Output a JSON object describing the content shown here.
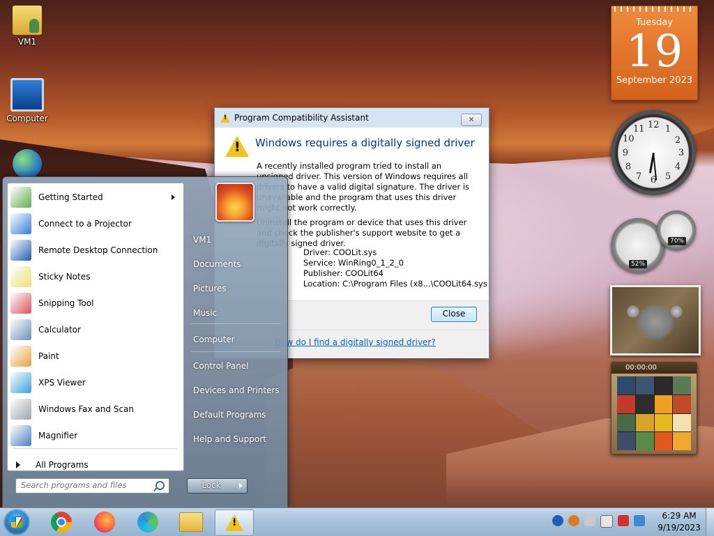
{
  "desktop": {
    "icons": [
      {
        "label": "VM1",
        "icon": "user-folder-icon"
      },
      {
        "label": "Computer",
        "icon": "computer-icon"
      },
      {
        "label": "",
        "icon": "network-icon"
      }
    ]
  },
  "gadgets": {
    "calendar": {
      "weekday": "Tuesday",
      "day": "19",
      "month_year": "September 2023"
    },
    "clock": {
      "numbers": [
        "12",
        "1",
        "2",
        "3",
        "4",
        "5",
        "6",
        "7",
        "8",
        "9",
        "10",
        "11"
      ]
    },
    "cpu_meter": {
      "cpu": "52%",
      "memory": "70%"
    },
    "puzzle": {
      "timer": "00:00:00"
    }
  },
  "dialog": {
    "title": "Program Compatibility Assistant",
    "heading": "Windows requires a digitally signed driver",
    "paragraph1": "A recently installed program tried to install an unsigned driver. This version of Windows requires all drivers to have a valid digital signature. The driver is unavailable and the program that uses this driver might not work correctly.",
    "paragraph2": "Uninstall the program or device that uses this driver and check the publisher's support website to get a digitally signed driver.",
    "driver": "Driver: COOLit.sys",
    "service": "Service: WinRing0_1_2_0",
    "publisher": "Publisher: COOLit64",
    "location": "Location: C:\\Program Files (x8...\\COOLit64.sys",
    "close_label": "Close",
    "link": "How do I find a digitally signed driver?"
  },
  "start_menu": {
    "programs": [
      {
        "label": "Getting Started",
        "icon": "getting-started-icon",
        "submenu": true,
        "color": "#5fae4c"
      },
      {
        "label": "Connect to a Projector",
        "icon": "projector-icon",
        "submenu": false,
        "color": "#2f7fd8"
      },
      {
        "label": "Remote Desktop Connection",
        "icon": "remote-desktop-icon",
        "submenu": false,
        "color": "#1d5fb0"
      },
      {
        "label": "Sticky Notes",
        "icon": "sticky-notes-icon",
        "submenu": false,
        "color": "#e8e070"
      },
      {
        "label": "Snipping Tool",
        "icon": "snipping-tool-icon",
        "submenu": false,
        "color": "#d9525e"
      },
      {
        "label": "Calculator",
        "icon": "calculator-icon",
        "submenu": false,
        "color": "#6d8fb6"
      },
      {
        "label": "Paint",
        "icon": "paint-icon",
        "submenu": false,
        "color": "#e8a23a"
      },
      {
        "label": "XPS Viewer",
        "icon": "xps-viewer-icon",
        "submenu": false,
        "color": "#3aa0d8"
      },
      {
        "label": "Windows Fax and Scan",
        "icon": "fax-scan-icon",
        "submenu": false,
        "color": "#9aa4ae"
      },
      {
        "label": "Magnifier",
        "icon": "magnifier-icon",
        "submenu": false,
        "color": "#4a7fbf"
      }
    ],
    "all_programs": "All Programs",
    "search_placeholder": "Search programs and files",
    "right_links": [
      "VM1",
      "Documents",
      "Pictures",
      "Music",
      "Computer",
      "Control Panel",
      "Devices and Printers",
      "Default Programs",
      "Help and Support"
    ],
    "lock_label": "Lock"
  },
  "taskbar": {
    "apps": [
      "start-orb",
      "chrome-icon",
      "firefox-icon",
      "edge-icon",
      "file-explorer-icon",
      "warning-icon"
    ],
    "time": "6:29 AM",
    "date": "9/19/2023"
  },
  "colors": {
    "accent": "#003399",
    "link": "#0066cc",
    "warning": "#f1c21b"
  }
}
